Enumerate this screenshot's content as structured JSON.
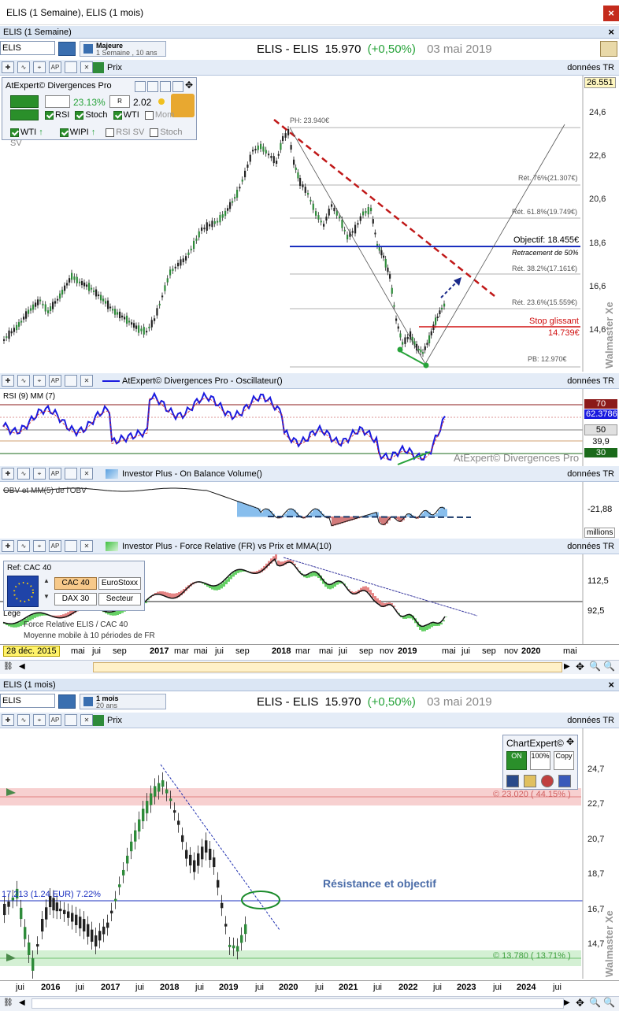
{
  "window": {
    "title": "ELIS (1 Semaine), ELIS (1 mois)",
    "close_label": "×"
  },
  "weekly": {
    "panel_title": "ELIS (1 Semaine)",
    "close": "×",
    "ticker": "ELIS",
    "period_main": "Majeure",
    "period_sub": "1 Semaine , 10 ans",
    "header": {
      "name": "ELIS - ELIS",
      "price": "15.970",
      "change": "(+0,50%)",
      "date": "03 mai 2019"
    },
    "price_tab": "Prix",
    "data_source": "données TR",
    "last_price_tag": "26.551",
    "y_labels": [
      "24,6",
      "22,6",
      "20,6",
      "18,6",
      "16,6",
      "14,6"
    ],
    "annotations": {
      "ph": "PH: 23.940€",
      "ret76": "Rét. 76%(21.307€)",
      "ret61": "Rét. 61.8%(19.749€)",
      "objectif": "Objectif: 18.455€",
      "retracement": "Retracement de 50%",
      "ret38": "Rét. 38.2%(17.161€)",
      "ret23": "Rét. 23.6%(15.559€)",
      "stop_label": "Stop glissant",
      "stop_value": "14.739€",
      "pb": "PB: 12.970€"
    },
    "watermark": "Walmaster Xe",
    "divergence_widget": {
      "title": "AtExpert© Divergences Pro",
      "pct": "23.13%",
      "ratio": "2.02",
      "checks_row1": [
        {
          "label": "RSI",
          "checked": true
        },
        {
          "label": "Stoch",
          "checked": true
        },
        {
          "label": "WTI",
          "checked": true
        },
        {
          "label": "Mom",
          "checked": false
        }
      ],
      "checks_row2": [
        {
          "label": "WTI",
          "checked": true
        },
        {
          "label": "WIPI",
          "checked": true
        },
        {
          "label": "RSI SV",
          "checked": false
        },
        {
          "label": "Stoch SV",
          "checked": false
        }
      ]
    },
    "oscillator": {
      "tab": "AtExpert© Divergences Pro - Oscillateur()",
      "data_source": "données TR",
      "legend": "RSI (9) MM (7)",
      "levels": [
        "70",
        "62.3786",
        "50",
        "39,9",
        "30"
      ],
      "brand": "AtExpert© Divergences Pro"
    },
    "obv": {
      "tab": "Investor Plus - On Balance Volume()",
      "data_source": "données TR",
      "legend": "OBV et MM(5) de l'OBV",
      "value": "-21,88",
      "unit": "millions"
    },
    "fr": {
      "tab": "Investor Plus - Force Relative (FR) vs Prix et MMA(10)",
      "data_source": "données TR",
      "ref_title": "Ref: CAC 40",
      "ref_buttons": [
        "CAC 40",
        "EuroStoxx",
        "DAX 30",
        "Secteur"
      ],
      "legend_line1": "Force Relative ELIS / CAC 40",
      "legend_line2": "Moyenne mobile à 10 périodes de FR",
      "legend_prefix": "Lege",
      "levels": [
        "112,5",
        "92,5"
      ]
    },
    "date_axis": {
      "current": "28 déc. 2015",
      "labels": [
        {
          "t": "mai",
          "y": false
        },
        {
          "t": "jui",
          "y": false
        },
        {
          "t": "sep",
          "y": false
        },
        {
          "t": "2017",
          "y": true
        },
        {
          "t": "mar",
          "y": false
        },
        {
          "t": "mai",
          "y": false
        },
        {
          "t": "jui",
          "y": false
        },
        {
          "t": "sep",
          "y": false
        },
        {
          "t": "2018",
          "y": true
        },
        {
          "t": "mar",
          "y": false
        },
        {
          "t": "mai",
          "y": false
        },
        {
          "t": "jui",
          "y": false
        },
        {
          "t": "sep",
          "y": false
        },
        {
          "t": "nov",
          "y": false
        },
        {
          "t": "2019",
          "y": true
        },
        {
          "t": "mai",
          "y": false
        },
        {
          "t": "jui",
          "y": false
        },
        {
          "t": "sep",
          "y": false
        },
        {
          "t": "nov",
          "y": false
        },
        {
          "t": "2020",
          "y": true
        },
        {
          "t": "mai",
          "y": false
        }
      ]
    }
  },
  "monthly": {
    "panel_title": "ELIS (1 mois)",
    "close": "×",
    "ticker": "ELIS",
    "period_main": "1 mois",
    "period_sub": "20 ans",
    "header": {
      "name": "ELIS - ELIS",
      "price": "15.970",
      "change": "(+0,50%)",
      "date": "03 mai 2019"
    },
    "price_tab": "Prix",
    "data_source": "données TR",
    "chartexpert_title": "ChartExpert©",
    "chartexpert_buttons": [
      "ON",
      "100%",
      "Copy"
    ],
    "y_labels": [
      "24,7",
      "22,7",
      "20,7",
      "18,7",
      "16,7",
      "14,7"
    ],
    "annotations": {
      "upper_zone": "© 23.020 ( 44.15% )",
      "lower_zone": "© 13.780 ( 13.71% )",
      "resistance_line": "17.213  (1.24 EUR)  7.22%",
      "resistance_text": "Résistance et objectif"
    },
    "watermark": "Walmaster Xe",
    "date_axis": {
      "labels": [
        {
          "t": "jui",
          "y": false
        },
        {
          "t": "2016",
          "y": true
        },
        {
          "t": "jui",
          "y": false
        },
        {
          "t": "2017",
          "y": true
        },
        {
          "t": "jui",
          "y": false
        },
        {
          "t": "2018",
          "y": true
        },
        {
          "t": "jui",
          "y": false
        },
        {
          "t": "2019",
          "y": true
        },
        {
          "t": "jui",
          "y": false
        },
        {
          "t": "2020",
          "y": true
        },
        {
          "t": "jui",
          "y": false
        },
        {
          "t": "2021",
          "y": true
        },
        {
          "t": "jui",
          "y": false
        },
        {
          "t": "2022",
          "y": true
        },
        {
          "t": "jui",
          "y": false
        },
        {
          "t": "2023",
          "y": true
        },
        {
          "t": "jui",
          "y": false
        },
        {
          "t": "2024",
          "y": true
        },
        {
          "t": "jui",
          "y": false
        }
      ]
    }
  },
  "colors": {
    "up_candle": "#2e8b3a",
    "down_candle": "#222222",
    "objective_line": "#1a2fbf",
    "stop_line": "#d01010",
    "downtrend": "#c01818",
    "rsi_line": "#1a1adf",
    "gain": "#27a33a"
  }
}
